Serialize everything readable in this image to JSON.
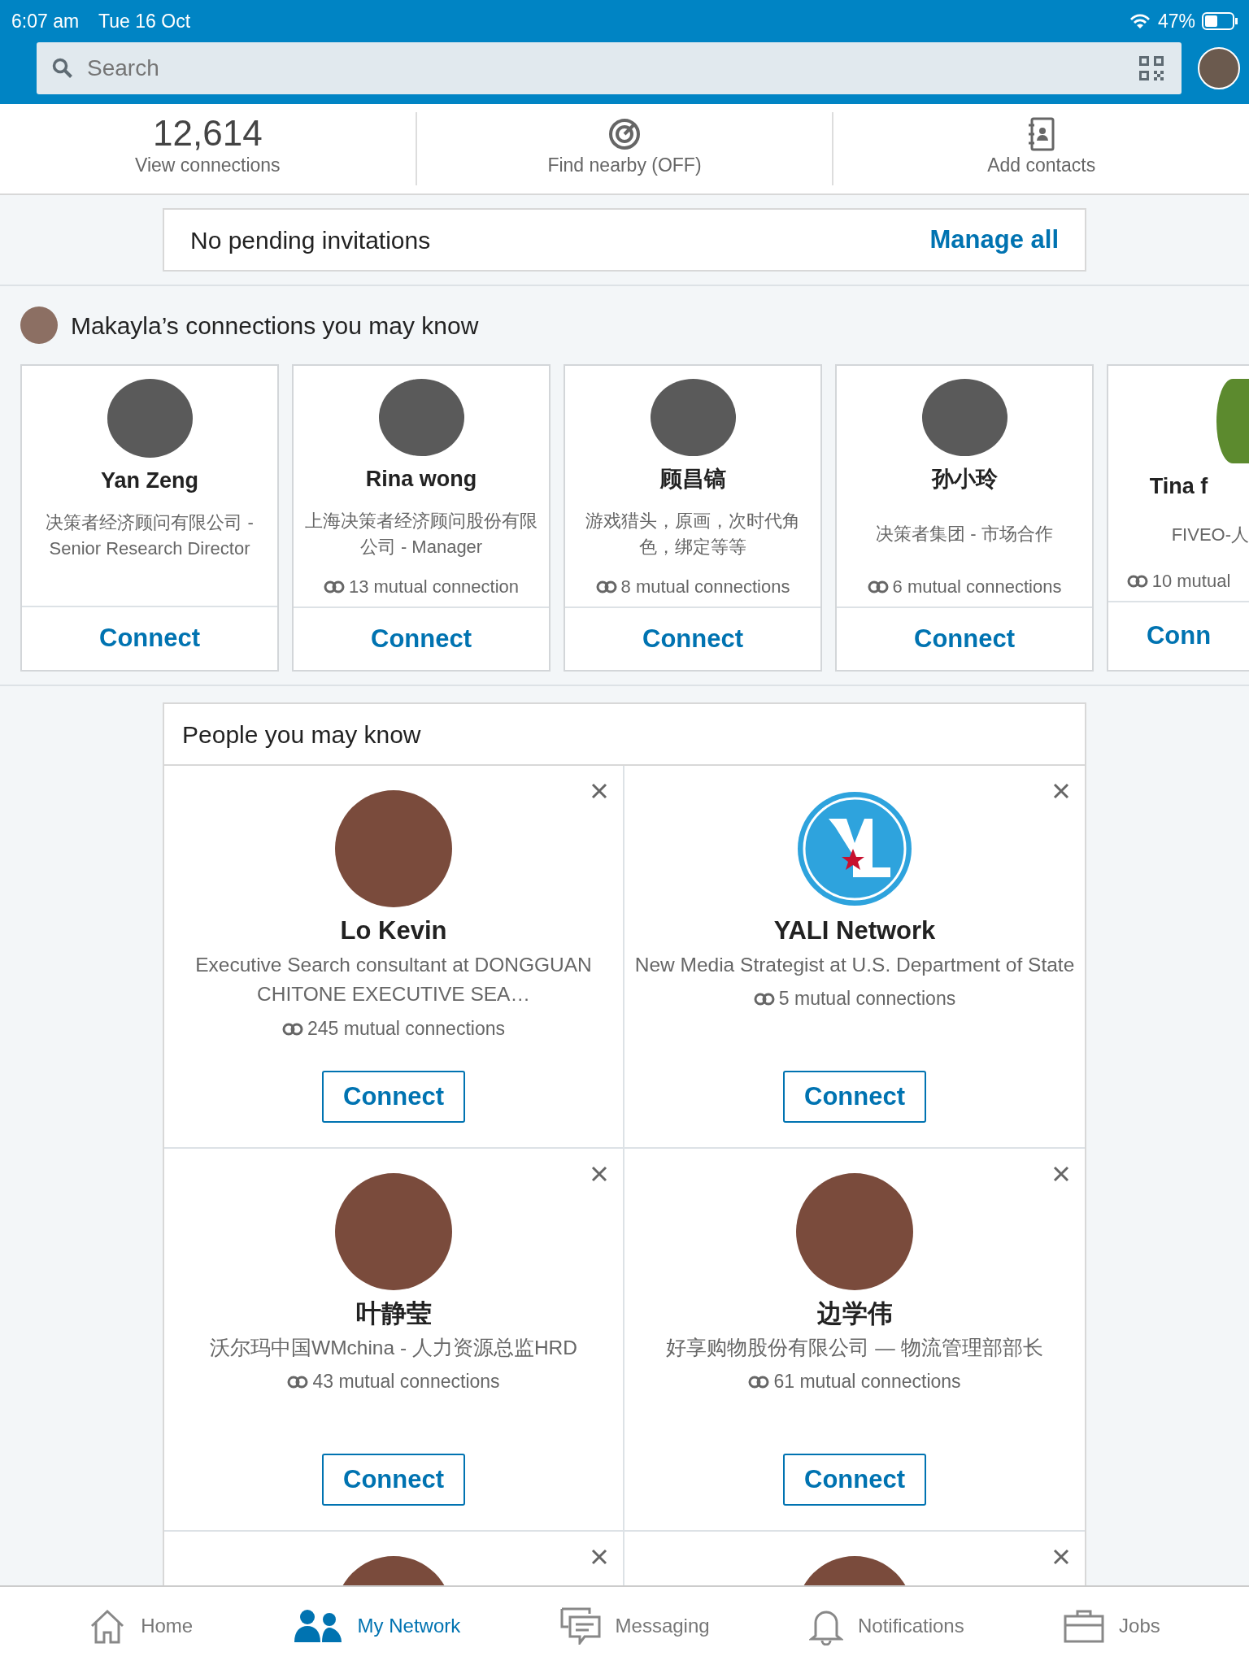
{
  "status_bar": {
    "time": "6:07 am",
    "date": "Tue 16 Oct",
    "battery": "47%"
  },
  "search": {
    "placeholder": "Search"
  },
  "stats": [
    {
      "kind": "count",
      "value": "12,614",
      "label": "View connections"
    },
    {
      "kind": "nearby",
      "label": "Find nearby (OFF)"
    },
    {
      "kind": "contacts",
      "label": "Add contacts"
    }
  ],
  "invitations": {
    "text": "No pending invitations",
    "action": "Manage all"
  },
  "suggested": {
    "title": "Makayla’s connections you may know",
    "cards": [
      {
        "kind": "full",
        "name": "Yan Zeng",
        "headline": "决策者经济顾问有限公司 - Senior Research Director",
        "button": "Connect"
      },
      {
        "kind": "full",
        "name": "Rina wong",
        "headline": "上海决策者经济顾问股份有限公司 - Manager",
        "mutual": "13 mutual connection",
        "button": "Connect"
      },
      {
        "kind": "full",
        "name": "顾昌镐",
        "headline": "游戏猎头，原画，次时代角色，绑定等等",
        "mutual": "8 mutual connections",
        "button": "Connect"
      },
      {
        "kind": "full",
        "name": "孙小玲",
        "headline": "决策者集团 - 市场合作",
        "mutual": "6 mutual connections",
        "button": "Connect"
      },
      {
        "kind": "cut",
        "name": "Tina f",
        "headline": "FIVEO-人",
        "mutual": "10 mutual",
        "button": "Conn"
      }
    ]
  },
  "people": {
    "title": "People you may know",
    "cards": [
      {
        "kind": "photo",
        "name": "Lo Kevin",
        "headline": "Executive Search consultant at DONGGUAN CHITONE EXECUTIVE SEA…",
        "mutual": "245 mutual connections",
        "button": "Connect"
      },
      {
        "kind": "logo",
        "name": "YALI Network",
        "headline": "New Media Strategist at U.S. Department of State",
        "mutual": "5 mutual connections",
        "button": "Connect"
      },
      {
        "kind": "photo",
        "name": "叶静莹",
        "headline": "沃尔玛中国WMchina - 人力资源总监HRD",
        "mutual": "43 mutual connections",
        "button": "Connect"
      },
      {
        "kind": "photo",
        "name": "边学伟",
        "headline": "好享购物股份有限公司 — 物流管理部部长",
        "mutual": "61 mutual connections",
        "button": "Connect"
      },
      {
        "kind": "partial"
      },
      {
        "kind": "partial"
      }
    ]
  },
  "nav": [
    {
      "kind": "home",
      "label": "Home",
      "selected": false
    },
    {
      "kind": "network",
      "label": "My Network",
      "selected": true
    },
    {
      "kind": "messaging",
      "label": "Messaging",
      "selected": false
    },
    {
      "kind": "notifications",
      "label": "Notifications",
      "selected": false
    },
    {
      "kind": "jobs",
      "label": "Jobs",
      "selected": false
    }
  ]
}
